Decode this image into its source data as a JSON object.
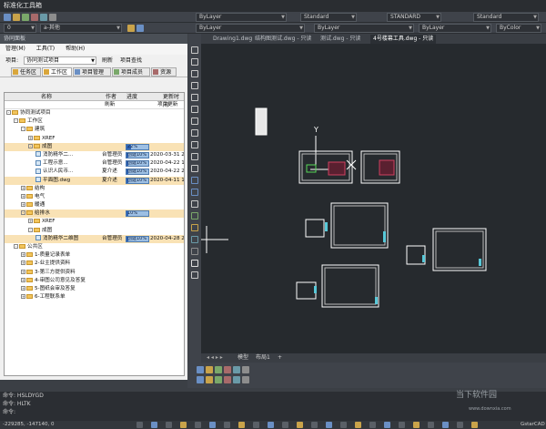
{
  "window": {
    "title": "标准化工具箱"
  },
  "toolbar": {
    "row1_combos": [
      "ByLayer",
      "Standard",
      "STANDARD",
      "Standard"
    ],
    "row1_layer": "ByLayer",
    "row2_layer": "0",
    "row2_prefix": "a-其他",
    "row2_combos": [
      "ByLayer",
      "ByLayer",
      "ByColor"
    ]
  },
  "panel": {
    "header": "协同面板",
    "menu": [
      "管理(M)",
      "工具(T)",
      "帮助(H)"
    ],
    "project_label": "项目:",
    "project_value": "协同测试项目",
    "refresh": "刷新",
    "project_query": "项目查找",
    "tabs": [
      "任务区",
      "工作区",
      "项目管理",
      "项目成员",
      "资源"
    ],
    "columns": [
      "名称",
      "作者",
      "进度",
      "更新时间"
    ],
    "subheader": {
      "author": "刷新",
      "update": "项目更新"
    },
    "rows": [
      {
        "indent": 0,
        "type": "folder",
        "name": "协同测试项目",
        "exp": "-"
      },
      {
        "indent": 1,
        "type": "folder",
        "name": "工作区",
        "exp": "-"
      },
      {
        "indent": 2,
        "type": "folder",
        "name": "建筑",
        "exp": "-"
      },
      {
        "indent": 3,
        "type": "folder",
        "name": "XREF",
        "exp": "+"
      },
      {
        "indent": 3,
        "type": "folder",
        "name": "成图",
        "exp": "-",
        "progress": 0.22,
        "progress_label": "22%",
        "highlight": true
      },
      {
        "indent": 4,
        "type": "file",
        "name": "消防精华二...",
        "author": "台管理员",
        "progress": 0.1,
        "progress_label": "创建10%",
        "date": "2020-03-31 20"
      },
      {
        "indent": 4,
        "type": "file",
        "name": "工程示意...",
        "author": "台管理员",
        "progress": 0.1,
        "progress_label": "创建10%",
        "date": "2020-04-22 13"
      },
      {
        "indent": 4,
        "type": "file",
        "name": "认识人民币...",
        "author": "夏介述",
        "progress": 0.1,
        "progress_label": "创建10%",
        "date": "2020-04-22 20"
      },
      {
        "indent": 4,
        "type": "file",
        "name": "平面图.dwg",
        "author": "夏介述",
        "progress": 0.1,
        "progress_label": "创建10%",
        "date": "2020-04-11 11",
        "highlight": true
      },
      {
        "indent": 2,
        "type": "folder",
        "name": "结构",
        "exp": "+"
      },
      {
        "indent": 2,
        "type": "folder",
        "name": "电气",
        "exp": "+"
      },
      {
        "indent": 2,
        "type": "folder",
        "name": "暖通",
        "exp": "+"
      },
      {
        "indent": 2,
        "type": "folder",
        "name": "给排水",
        "exp": "-",
        "progress": 0.1,
        "progress_label": "10%",
        "highlight": true
      },
      {
        "indent": 3,
        "type": "folder",
        "name": "XREF",
        "exp": "+"
      },
      {
        "indent": 3,
        "type": "folder",
        "name": "成图",
        "exp": "-"
      },
      {
        "indent": 4,
        "type": "file",
        "name": "消防精华二维图",
        "author": "台管理员",
        "progress": 0.1,
        "progress_label": "创建10%",
        "date": "2020-04-28 20",
        "highlight": true
      },
      {
        "indent": 1,
        "type": "folder",
        "name": "公共区",
        "exp": "-"
      },
      {
        "indent": 2,
        "type": "folder",
        "name": "1-质量记录表单",
        "exp": "+"
      },
      {
        "indent": 2,
        "type": "folder",
        "name": "2-业主提供资料",
        "exp": "+"
      },
      {
        "indent": 2,
        "type": "folder",
        "name": "3-第三方提供资料",
        "exp": "+"
      },
      {
        "indent": 2,
        "type": "folder",
        "name": "4-审图公司意见及答复",
        "exp": "+"
      },
      {
        "indent": 2,
        "type": "folder",
        "name": "5-图纸会审及答复",
        "exp": "+"
      },
      {
        "indent": 2,
        "type": "folder",
        "name": "6-工程联系单",
        "exp": "+"
      }
    ]
  },
  "documents": {
    "tabs": [
      "Drawing1.dwg",
      "结构图测试.dwg - 只读",
      "测试.dwg - 只读",
      "4号楼幕工具.dwg - 只读"
    ],
    "active_tab": 3
  },
  "layout_tabs": [
    "模型",
    "布局1",
    "+"
  ],
  "axis_label": "Y",
  "command": {
    "lines": [
      "命令: HSLDYGD",
      "命令: HLTK",
      "命令:"
    ]
  },
  "status": {
    "coords": "-229285, -147140, 0",
    "app": "GstarCAD"
  },
  "watermark": {
    "line1": "当下软件园",
    "line2": "www.downxia.com"
  },
  "colors": {
    "canvas": "#262a2e",
    "highlight": "#f9e2b5",
    "accent": "#2f64b5"
  }
}
